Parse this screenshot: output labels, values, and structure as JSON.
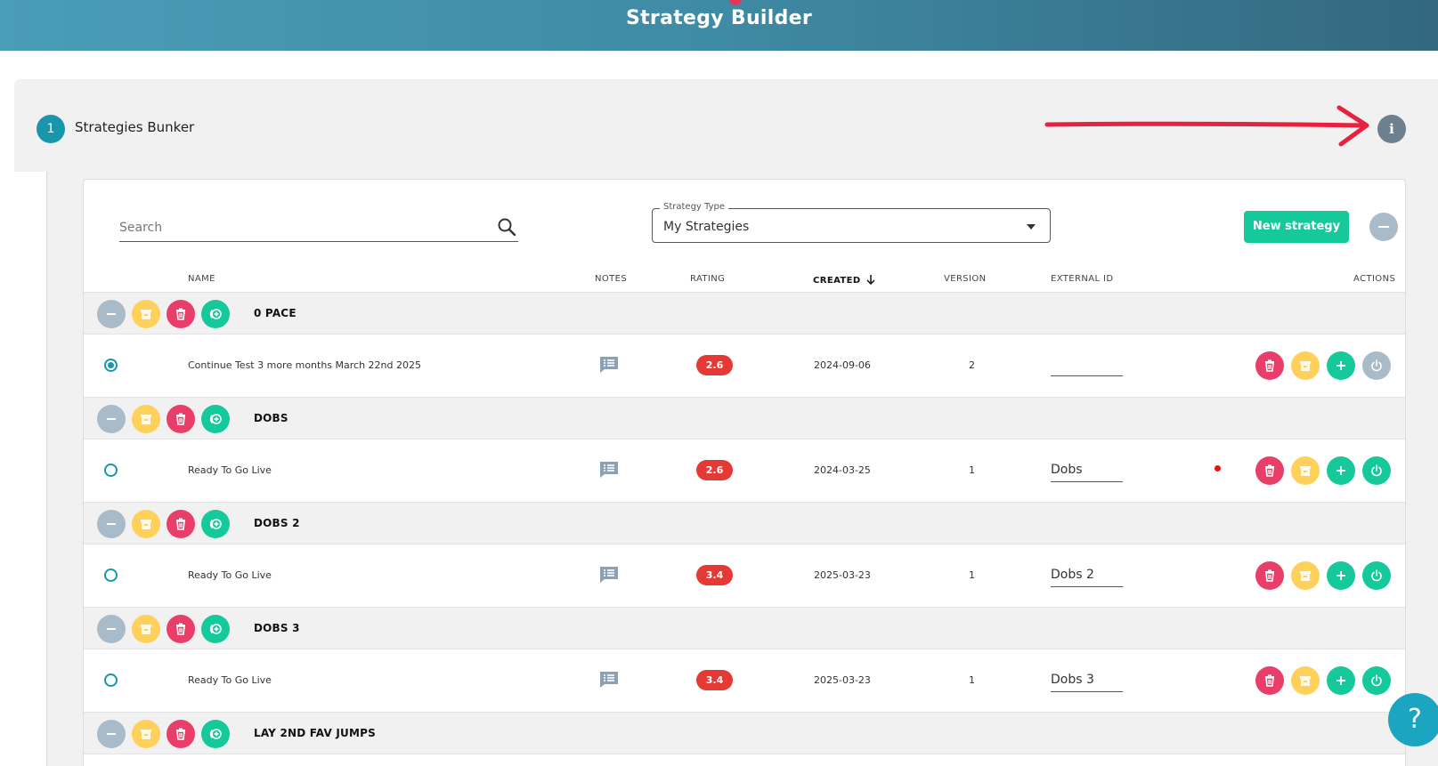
{
  "header": {
    "title": "Strategy Builder"
  },
  "panel": {
    "step": "1",
    "title": "Strategies Bunker",
    "info_glyph": "i"
  },
  "search": {
    "placeholder": "Search",
    "value": ""
  },
  "strategy_type": {
    "label": "Strategy Type",
    "value": "My Strategies"
  },
  "toolbar": {
    "new_strategy_label": "New strategy"
  },
  "columns": {
    "name": "NAME",
    "notes": "NOTES",
    "rating": "RATING",
    "created": "CREATED",
    "version": "VERSION",
    "external_id": "EXTERNAL ID",
    "actions": "ACTIONS"
  },
  "groups": [
    {
      "name": "0 PACE",
      "strategy": {
        "name": "Continue Test 3 more months March 22nd 2025",
        "rating": "2.6",
        "created": "2024-09-06",
        "version": "2",
        "external_id": "",
        "selected": true,
        "active": false
      }
    },
    {
      "name": "DOBS",
      "strategy": {
        "name": "Ready To Go Live",
        "rating": "2.6",
        "created": "2024-03-25",
        "version": "1",
        "external_id": "Dobs",
        "selected": false,
        "active": true
      }
    },
    {
      "name": "DOBS 2",
      "strategy": {
        "name": "Ready To Go Live",
        "rating": "3.4",
        "created": "2025-03-23",
        "version": "1",
        "external_id": "Dobs 2",
        "selected": false,
        "active": true
      }
    },
    {
      "name": "DOBS 3",
      "strategy": {
        "name": "Ready To Go Live",
        "rating": "3.4",
        "created": "2025-03-23",
        "version": "1",
        "external_id": "Dobs 3",
        "selected": false,
        "active": true
      }
    },
    {
      "name": "LAY 2ND FAV JUMPS"
    }
  ],
  "help": {
    "glyph": "?"
  },
  "colors": {
    "accent": "#1996ac",
    "green": "#16c99b",
    "red": "#ea3e6a",
    "yellow": "#ffd05a",
    "grey": "#a9bac9",
    "rating": "#e53935"
  }
}
